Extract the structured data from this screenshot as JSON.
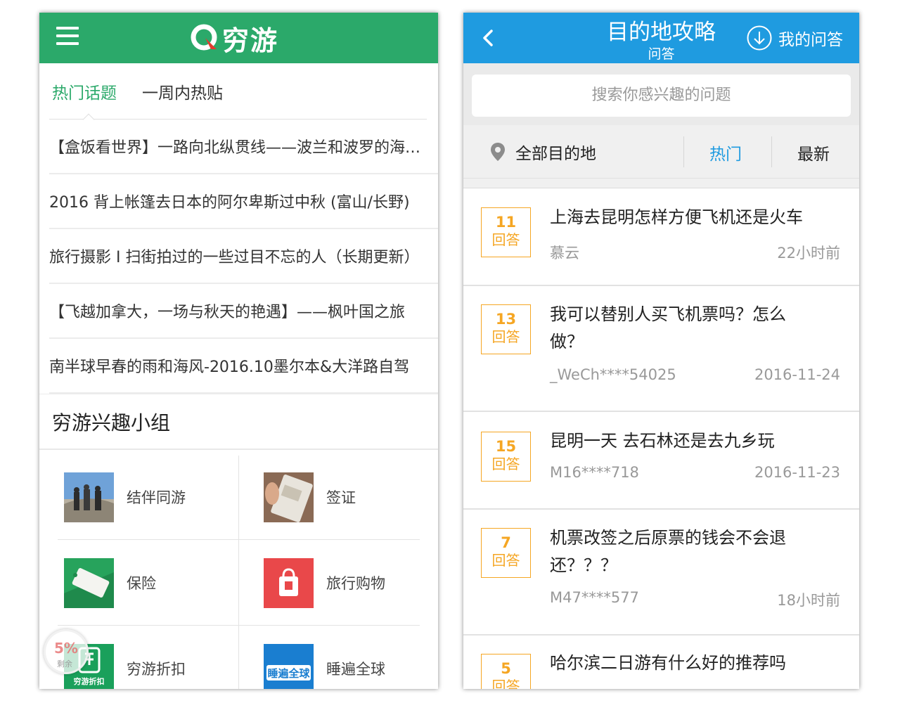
{
  "left": {
    "logo_text": "穷游",
    "tabs": [
      "热门话题",
      "一周内热贴"
    ],
    "posts": [
      "【盒饭看世界】一路向北纵贯线——波兰和波罗的海三国",
      "2016 背上帐篷去日本的阿尔卑斯过中秋 (富山/长野)",
      "旅行摄影 I 扫街拍过的一些过目不忘的人（长期更新）",
      "【飞越加拿大，一场与秋天的艳遇】——枫叶国之旅",
      "南半球早春的雨和海风-2016.10墨尔本&大洋路自驾"
    ],
    "group_title": "穷游兴趣小组",
    "groups": [
      "结伴同游",
      "签证",
      "保险",
      "旅行购物",
      "穷游折扣",
      "睡遍全球"
    ],
    "float_badge": {
      "pct": "5%",
      "rem": "剩余"
    },
    "colors": {
      "brand": "#2ba96a"
    }
  },
  "right": {
    "title": "目的地攻略",
    "subtitle": "问答",
    "my_qa": "我的问答",
    "search_placeholder": "搜索你感兴趣的问题",
    "filter": {
      "location": "全部目的地",
      "hot": "热门",
      "newest": "最新"
    },
    "questions": [
      {
        "count": "11",
        "count_label": "回答",
        "title": "上海去昆明怎样方便飞机还是火车",
        "user": "慕云",
        "time": "22小时前"
      },
      {
        "count": "13",
        "count_label": "回答",
        "title": "我可以替别人买飞机票吗？怎么做？",
        "user": "_WeCh****54025",
        "time": "2016-11-24"
      },
      {
        "count": "15",
        "count_label": "回答",
        "title": "昆明一天 去石林还是去九乡玩",
        "user": "M16****718",
        "time": "2016-11-23"
      },
      {
        "count": "7",
        "count_label": "回答",
        "title": "机票改签之后原票的钱会不会退还？？？",
        "user": "M47****577",
        "time": "18小时前"
      },
      {
        "count": "5",
        "count_label": "回答",
        "title": "哈尔滨二日游有什么好的推荐吗",
        "user": "",
        "time": ""
      }
    ],
    "colors": {
      "header": "#1f9be0",
      "badge": "#f5a623"
    }
  }
}
